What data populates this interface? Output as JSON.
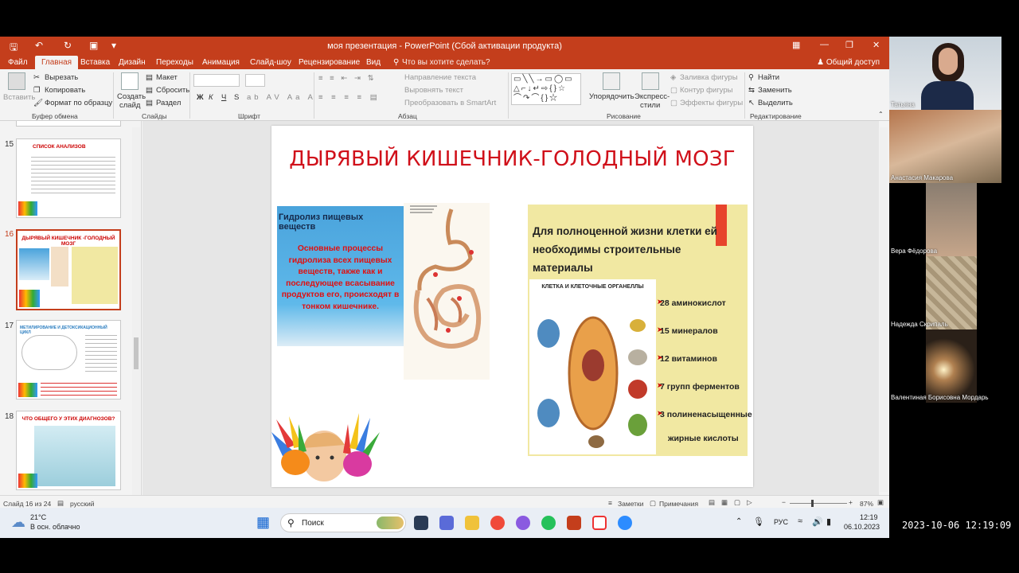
{
  "window": {
    "title": "моя презентация - PowerPoint (Сбой активации продукта)"
  },
  "menu": {
    "tabs": [
      "Файл",
      "Главная",
      "Вставка",
      "Дизайн",
      "Переходы",
      "Анимация",
      "Слайд-шоу",
      "Рецензирование",
      "Вид"
    ],
    "tell_me": "Что вы хотите сделать?",
    "share": "Общий доступ"
  },
  "ribbon": {
    "clipboard": {
      "paste": "Вставить",
      "cut": "Вырезать",
      "copy": "Копировать",
      "format_painter": "Формат по образцу",
      "label": "Буфер обмена"
    },
    "slides": {
      "new_slide_1": "Создать",
      "new_slide_2": "слайд",
      "layout": "Макет",
      "reset": "Сбросить",
      "section": "Раздел",
      "label": "Слайды"
    },
    "font": {
      "bold": "Ж",
      "italic": "К",
      "underline": "Ч",
      "strike": "S",
      "label": "Шрифт"
    },
    "paragraph": {
      "text_direction": "Направление текста",
      "align_text": "Выровнять текст",
      "smartart": "Преобразовать в SmartArt",
      "label": "Абзац"
    },
    "drawing": {
      "arrange": "Упорядочить",
      "quick_styles_1": "Экспресс-",
      "quick_styles_2": "стили",
      "fill": "Заливка фигуры",
      "outline": "Контур фигуры",
      "effects": "Эффекты фигуры",
      "label": "Рисование"
    },
    "editing": {
      "find": "Найти",
      "replace": "Заменить",
      "select": "Выделить",
      "label": "Редактирование"
    }
  },
  "thumbnails": [
    {
      "num": "15",
      "title": "СПИСОК АНАЛИЗОВ"
    },
    {
      "num": "16",
      "title": "ДЫРЯВЫЙ КИШЕЧНИК -ГОЛОДНЫЙ МОЗГ"
    },
    {
      "num": "17",
      "title": "МЕТИЛИРОВАНИЕ И ДЕТОКСИКАЦИОННЫЙ ЦИКЛ"
    },
    {
      "num": "18",
      "title": "ЧТО ОБЩЕГО У ЭТИХ ДИАГНОЗОВ?"
    }
  ],
  "slide": {
    "title": "ДЫРЯВЫЙ КИШЕЧНИК-ГОЛОДНЫЙ МОЗГ",
    "hydro_title": "Гидролиз пищевых веществ",
    "hydro_body": "Основные процессы гидролиза всех пищевых веществ, также как и последующее всасывание продуктов его, происходят в тонком кишечнике.",
    "cell_title": "Для полноценной жизни клетки ей необходимы строительные материалы",
    "cell_image_title": "КЛЕТКА И КЛЕТОЧНЫЕ ОРГАНЕЛЛЫ",
    "needs": [
      "28 аминокислот",
      "15 минералов",
      "12 витаминов",
      "7 групп ферментов",
      "3 полиненасыщенные",
      "жирные кислоты"
    ]
  },
  "status": {
    "slide_info": "Слайд 16 из 24",
    "language": "русский",
    "notes": "Заметки",
    "comments": "Примечания",
    "zoom": "87%"
  },
  "taskbar": {
    "weather_temp": "21°C",
    "weather_desc": "В осн. облачно",
    "search": "Поиск",
    "lang": "РУС",
    "time": "12:19",
    "date": "06.10.2023"
  },
  "participants": [
    "Татьяна",
    "Анастасия Макарова",
    "Вера Фёдорова",
    "Надежда Скрипаль",
    "Валентиная Борисовна Мордарь"
  ],
  "recording_timestamp": "2023-10-06 12:19:09",
  "colors": {
    "accent": "#c43e1c",
    "slide_title": "#d0101a",
    "hydro_blue": "#4aa3dc",
    "cell_panel": "#f1e8a2"
  }
}
